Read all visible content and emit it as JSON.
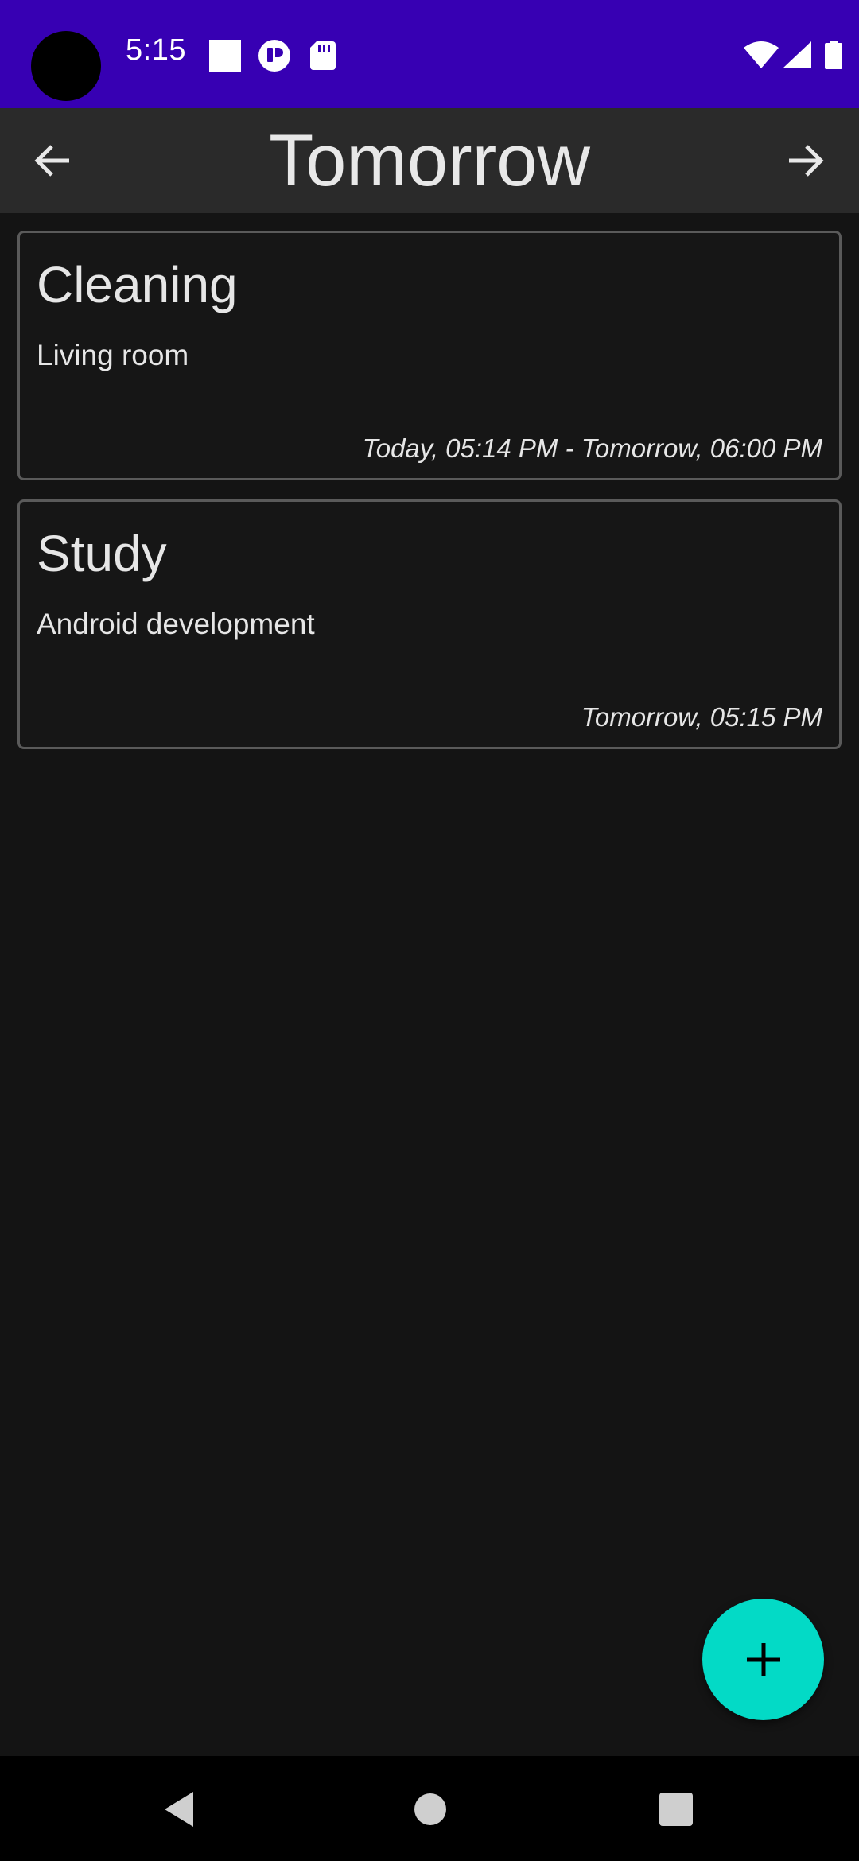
{
  "status_bar": {
    "time": "5:15",
    "background_color": "#3700b3",
    "left_icons": [
      "square-notification-icon",
      "circle-notification-icon",
      "sd-card-icon"
    ],
    "right_icons": [
      "wifi-icon",
      "cell-signal-icon",
      "battery-icon"
    ]
  },
  "app_bar": {
    "title": "Tomorrow",
    "prev_icon": "arrow-left-icon",
    "next_icon": "arrow-right-icon",
    "background_color": "#2a2a2a"
  },
  "tasks": [
    {
      "title": "Cleaning",
      "subtitle": "Living room",
      "time": "Today, 05:14 PM - Tomorrow, 06:00 PM"
    },
    {
      "title": "Study",
      "subtitle": "Android development",
      "time": "Tomorrow, 05:15 PM"
    }
  ],
  "fab": {
    "icon": "plus-icon",
    "color": "#03dac6"
  },
  "system_nav": {
    "icons": [
      "back-triangle-icon",
      "home-circle-icon",
      "recents-square-icon"
    ]
  },
  "colors": {
    "background": "#141414",
    "card_border": "#5a5a5a",
    "text": "#e6e6e6"
  }
}
